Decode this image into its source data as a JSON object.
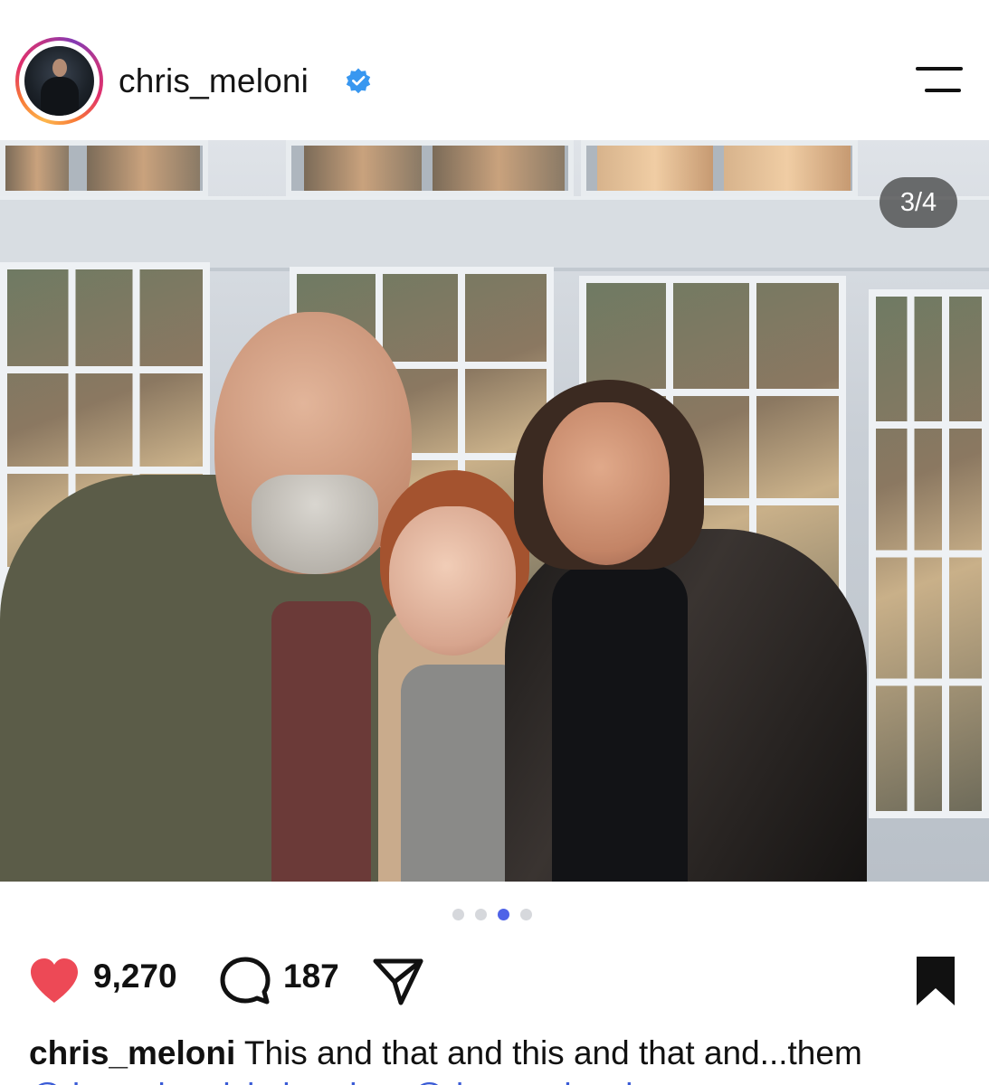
{
  "header": {
    "username": "chris_meloni",
    "verified": true,
    "avatar_icon": "profile-avatar",
    "menu_icon": "hamburger-menu-icon"
  },
  "post": {
    "carousel_counter": "3/4",
    "carousel_total": 4,
    "carousel_active_index": 3,
    "photo_description_icon": "photo"
  },
  "actions": {
    "likes": "9,270",
    "comments": "187",
    "liked": true,
    "heart_color": "#ed4956",
    "saved": true
  },
  "caption": {
    "username": "chris_meloni",
    "text": "This and that and this and that and...them",
    "mentions_line": "@therealmariskahargitay @dawnmdowd..."
  },
  "colors": {
    "accent_blue": "#4f63e7",
    "verified_blue": "#3897f0",
    "mention_blue": "#3a5bd6"
  }
}
